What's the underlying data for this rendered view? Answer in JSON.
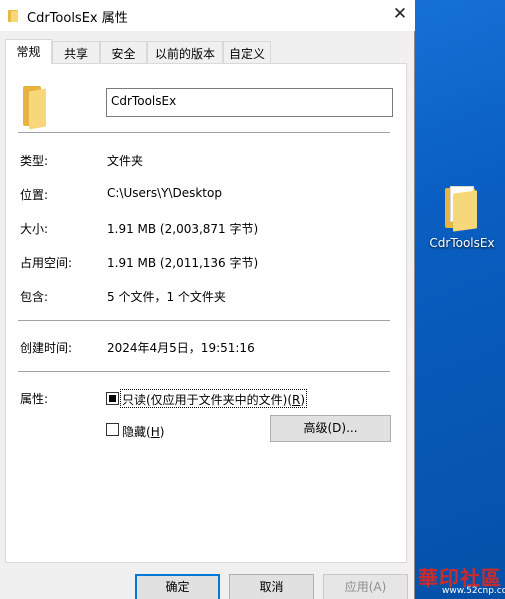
{
  "desktop": {
    "icon_label": "CdrToolsEx",
    "watermark_text": "華印社區",
    "watermark_url": "www.52cnp.com"
  },
  "window": {
    "title": "CdrToolsEx 属性",
    "close_glyph": "✕"
  },
  "tabs": [
    "常规",
    "共享",
    "安全",
    "以前的版本",
    "自定义"
  ],
  "general": {
    "name_value": "CdrToolsEx",
    "rows": [
      {
        "label": "类型:",
        "value": "文件夹"
      },
      {
        "label": "位置:",
        "value": "C:\\Users\\Y\\Desktop"
      },
      {
        "label": "大小:",
        "value": "1.91 MB (2,003,871 字节)"
      },
      {
        "label": "占用空间:",
        "value": "1.91 MB (2,011,136 字节)"
      },
      {
        "label": "包含:",
        "value": "5 个文件，1 个文件夹"
      },
      {
        "label": "创建时间:",
        "value": "2024年4月5日，19:51:16"
      }
    ],
    "attributes_label": "属性:",
    "readonly": {
      "label": "只读(仅应用于文件夹中的文件)(",
      "key": "R",
      "tail": ")",
      "state": "indeterminate"
    },
    "hidden": {
      "label": "隐藏(",
      "key": "H",
      "tail": ")",
      "checked": false
    },
    "advanced_button": "高级(D)..."
  },
  "buttons": {
    "ok": "确定",
    "cancel": "取消",
    "apply": "应用(A)"
  },
  "colors": {
    "dialog_bg": "#f0f0f0",
    "panel_bg": "#ffffff",
    "default_button_border": "#0078d7",
    "desktop_bg": "#0a5fc2"
  }
}
